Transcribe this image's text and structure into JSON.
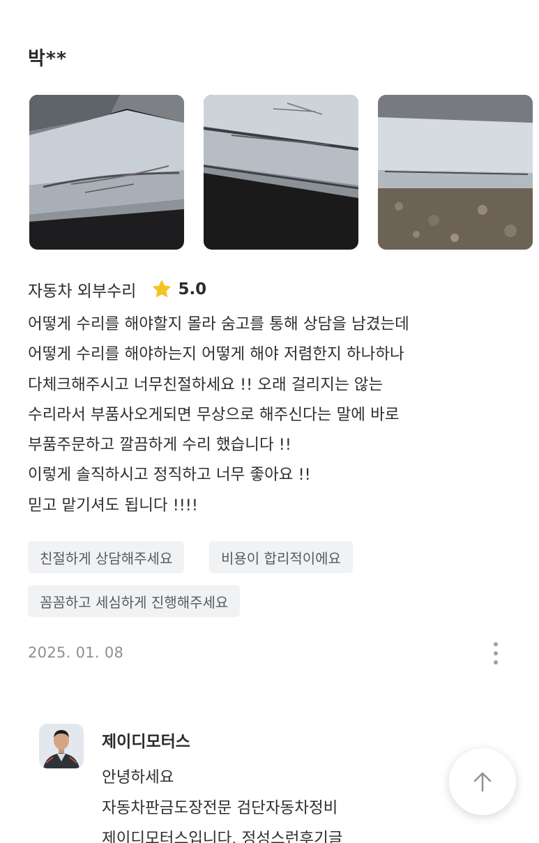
{
  "review": {
    "reviewer_name": "박**",
    "photos": [
      {
        "alt": "차량 하단 스크래치 사진 1"
      },
      {
        "alt": "차량 하단 스크래치 사진 2"
      },
      {
        "alt": "차량 하단 스크래치 사진 3"
      }
    ],
    "service_name": "자동차 외부수리",
    "rating": "5.0",
    "body_lines": [
      "어떻게 수리를 해야할지 몰라 숨고를 통해 상담을 남겼는데",
      "어떻게 수리를 해야하는지 어떻게 해야 저렴한지 하나하나",
      "다체크해주시고 너무친절하세요 !!  오래 걸리지는 않는",
      "수리라서 부품사오게되면 무상으로 해주신다는 말에 바로",
      "부품주문하고 깔끔하게 수리 했습니다 !!",
      "이렇게 솔직하시고 정직하고 너무 좋아요 !!",
      "믿고 맡기셔도 됩니다 !!!!"
    ],
    "tags": [
      "친절하게 상담해주세요",
      "비용이 합리적이에요",
      "꼼꼼하고 세심하게 진행해주세요"
    ],
    "date": "2025. 01. 08"
  },
  "reply": {
    "business_name": "제이디모터스",
    "lines": [
      "안녕하세요",
      "자동차판금도장전문 검단자동차정비",
      "제이디모터스입니다. 정성스런후기글"
    ]
  },
  "icons": {
    "star": "star-icon",
    "more": "more-vertical-icon",
    "scroll_top": "arrow-up-icon"
  },
  "colors": {
    "star": "#f6c324",
    "tag_bg": "#f1f2f4",
    "muted_text": "#8c9096"
  }
}
